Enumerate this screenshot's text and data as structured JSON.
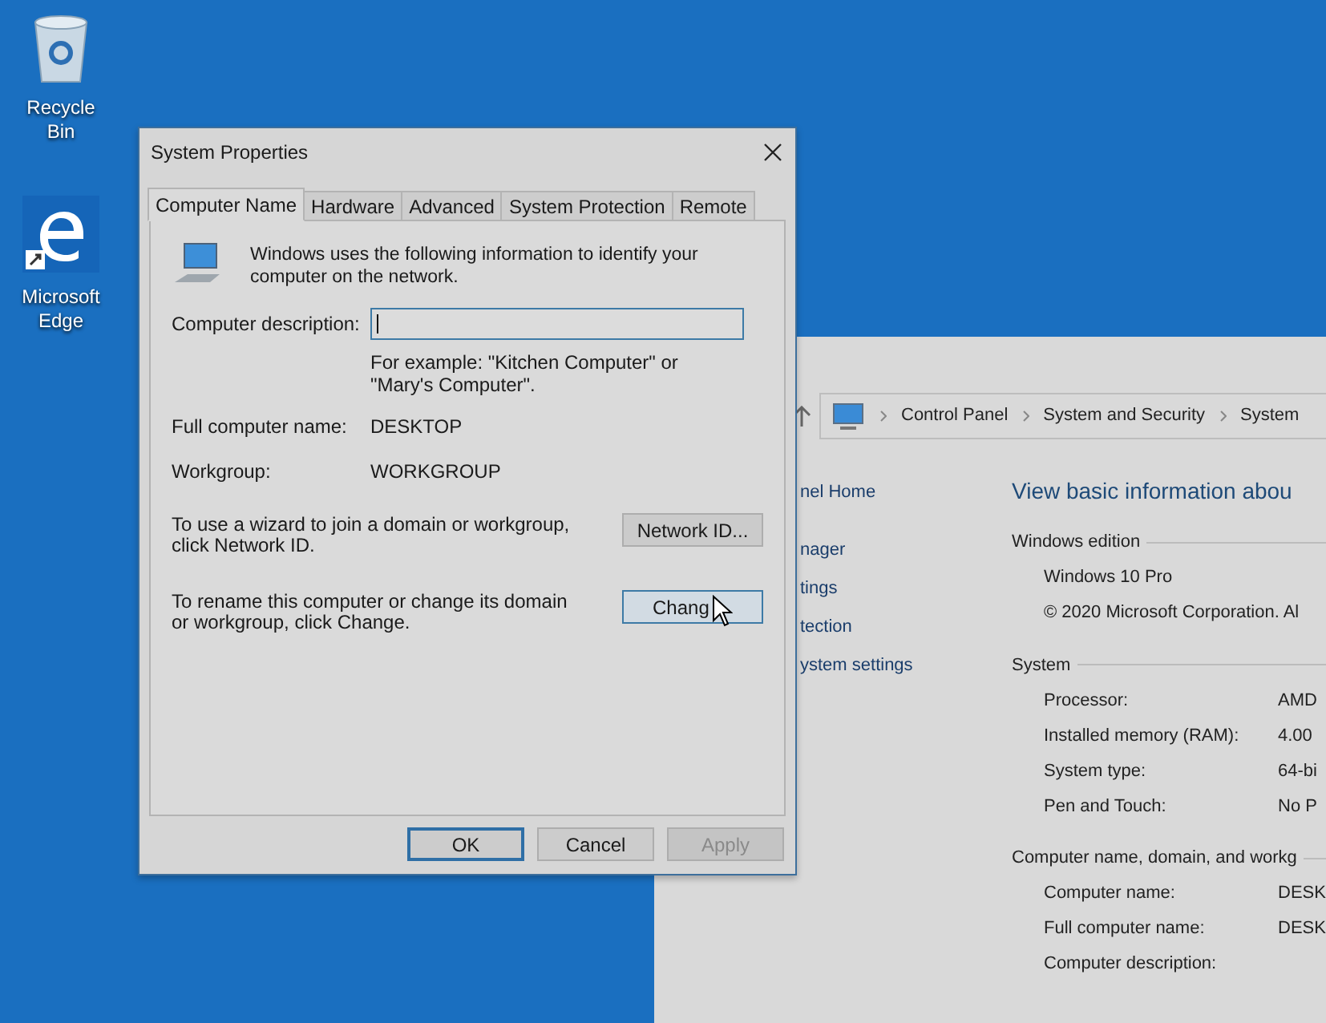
{
  "desktop_icons": [
    {
      "kind": "recycle",
      "label": "Recycle Bin"
    },
    {
      "kind": "edge",
      "label": "Microsoft Edge"
    }
  ],
  "background_window": {
    "breadcrumb": [
      "Control Panel",
      "System and Security",
      "System"
    ],
    "left_links": [
      "nel Home",
      "nager",
      "tings",
      "tection",
      "ystem settings"
    ],
    "heading": "View basic information abou",
    "sections": [
      {
        "title": "Windows edition",
        "rows": [
          {
            "value": "Windows 10 Pro"
          },
          {
            "value": "© 2020 Microsoft Corporation. Al"
          }
        ]
      },
      {
        "title": "System",
        "rows": [
          {
            "label": "Processor:",
            "value": "AMD"
          },
          {
            "label": "Installed memory (RAM):",
            "value": "4.00"
          },
          {
            "label": "System type:",
            "value": "64-bi"
          },
          {
            "label": "Pen and Touch:",
            "value": "No P"
          }
        ]
      },
      {
        "title": "Computer name, domain, and workg",
        "rows": [
          {
            "label": "Computer name:",
            "value": "DESK"
          },
          {
            "label": "Full computer name:",
            "value": "DESK"
          },
          {
            "label": "Computer description:"
          }
        ]
      }
    ]
  },
  "dialog": {
    "title": "System Properties",
    "tabs": [
      {
        "label": "Computer Name",
        "selected": true
      },
      {
        "label": "Hardware",
        "selected": false
      },
      {
        "label": "Advanced",
        "selected": false
      },
      {
        "label": "System Protection",
        "selected": false
      },
      {
        "label": "Remote",
        "selected": false
      }
    ],
    "intro": "Windows uses the following information to identify your computer on the network.",
    "description_label": "Computer description:",
    "description_hint": "For example: \"Kitchen Computer\" or \"Mary's Computer\".",
    "fields": [
      {
        "label": "Full computer name:",
        "value": "DESKTOP"
      },
      {
        "label": "Workgroup:",
        "value": "WORKGROUP"
      }
    ],
    "actions": [
      {
        "text": "To use a wizard to join a domain or workgroup, click Network ID.",
        "button": "Network ID...",
        "focused": false
      },
      {
        "text": "To rename this computer or change its domain or workgroup, click Change.",
        "button": "Chang",
        "focused": true
      }
    ],
    "buttons": [
      {
        "label": "OK",
        "default": true,
        "disabled": false
      },
      {
        "label": "Cancel",
        "default": false,
        "disabled": false
      },
      {
        "label": "Apply",
        "default": false,
        "disabled": true
      }
    ]
  }
}
